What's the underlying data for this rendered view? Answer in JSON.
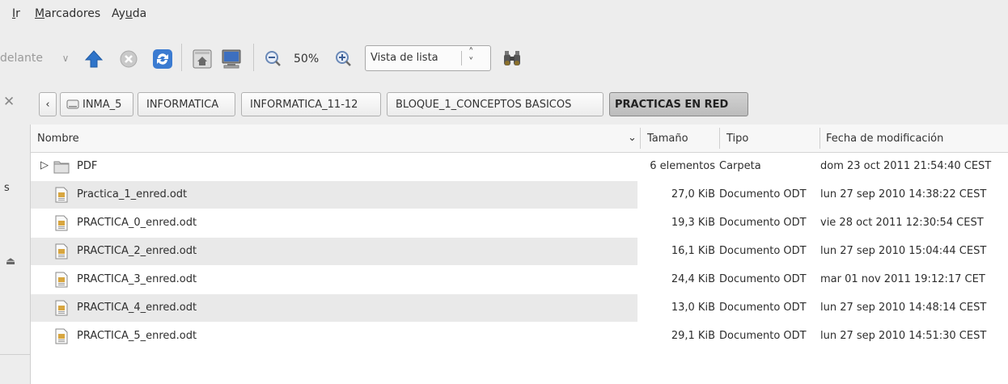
{
  "menu": [
    {
      "mnemonic": "I",
      "rest": "r"
    },
    {
      "mnemonic": "M",
      "rest": "arcadores"
    },
    {
      "pre": "Ay",
      "mnemonic": "u",
      "rest": "da"
    }
  ],
  "toolbar": {
    "forward_label": "delante",
    "zoom_value": "50%",
    "view_select": "Vista de lista"
  },
  "breadcrumbs": [
    "INMA_5",
    "INFORMATICA",
    "INFORMATICA_11-12",
    "BLOQUE_1_CONCEPTOS BASICOS",
    "PRACTICAS EN RED"
  ],
  "sidebar": {
    "partial_label": "s"
  },
  "columns": {
    "name": "Nombre",
    "size": "Tamaño",
    "type": "Tipo",
    "modified": "Fecha de modificación"
  },
  "files": [
    {
      "name": "PDF",
      "size": "6 elementos",
      "type": "Carpeta",
      "modified": "dom 23 oct 2011 21:54:40 CEST",
      "kind": "folder"
    },
    {
      "name": "Practica_1_enred.odt",
      "size": "27,0 KiB",
      "type": "Documento ODT",
      "modified": "lun 27 sep 2010 14:38:22 CEST",
      "kind": "odt"
    },
    {
      "name": "PRACTICA_0_enred.odt",
      "size": "19,3 KiB",
      "type": "Documento ODT",
      "modified": "vie 28 oct 2011 12:30:54 CEST",
      "kind": "odt"
    },
    {
      "name": "PRACTICA_2_enred.odt",
      "size": "16,1 KiB",
      "type": "Documento ODT",
      "modified": "lun 27 sep 2010 15:04:44 CEST",
      "kind": "odt"
    },
    {
      "name": "PRACTICA_3_enred.odt",
      "size": "24,4 KiB",
      "type": "Documento ODT",
      "modified": "mar 01 nov 2011 19:12:17 CET",
      "kind": "odt"
    },
    {
      "name": "PRACTICA_4_enred.odt",
      "size": "13,0 KiB",
      "type": "Documento ODT",
      "modified": "lun 27 sep 2010 14:48:14 CEST",
      "kind": "odt"
    },
    {
      "name": "PRACTICA_5_enred.odt",
      "size": "29,1 KiB",
      "type": "Documento ODT",
      "modified": "lun 27 sep 2010 14:51:30 CEST",
      "kind": "odt"
    }
  ],
  "colors": {
    "row_alt": "#e9e9e9",
    "toolbar_bg": "#ededed",
    "active_crumb": "#c4c4c4"
  }
}
